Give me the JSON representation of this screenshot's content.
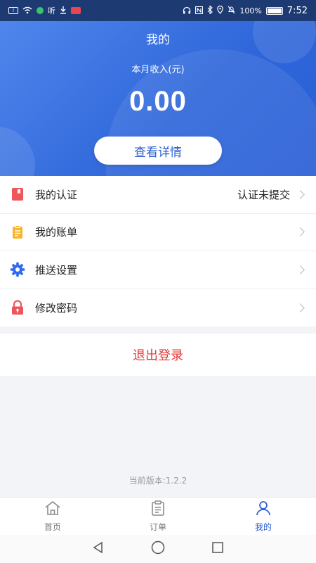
{
  "status_bar": {
    "time": "7:52",
    "battery": "100%",
    "net_label": "听",
    "icons": [
      "sim-icon",
      "wifi-icon",
      "app-dot-icon",
      "download-icon",
      "app-badge-icon",
      "headset-icon",
      "nfc-icon",
      "bluetooth-icon",
      "location-icon",
      "mute-icon",
      "battery-icon"
    ]
  },
  "header": {
    "title": "我的",
    "income_label": "本月收入(元)",
    "income_value": "0.00",
    "detail_button": "查看详情",
    "colors": {
      "gradient_start": "#4f86ec",
      "gradient_end": "#2a5fd6"
    }
  },
  "menu": {
    "items": [
      {
        "label": "我的认证",
        "value": "认证未提交",
        "icon": "bookmark-icon",
        "icon_color": "#f0555a"
      },
      {
        "label": "我的账单",
        "value": "",
        "icon": "clipboard-icon",
        "icon_color": "#f7b529"
      },
      {
        "label": "推送设置",
        "value": "",
        "icon": "gear-icon",
        "icon_color": "#2d6cf0"
      },
      {
        "label": "修改密码",
        "value": "",
        "icon": "lock-icon",
        "icon_color": "#f0555a"
      }
    ]
  },
  "logout": {
    "label": "退出登录",
    "color": "#e43a3a"
  },
  "version": "当前版本:1.2.2",
  "tabs": [
    {
      "label": "首页",
      "icon": "home-icon",
      "active": false
    },
    {
      "label": "订单",
      "icon": "order-icon",
      "active": false
    },
    {
      "label": "我的",
      "icon": "person-icon",
      "active": true
    }
  ],
  "nav": {
    "icons": [
      "back-icon",
      "home-nav-icon",
      "recents-icon"
    ]
  }
}
